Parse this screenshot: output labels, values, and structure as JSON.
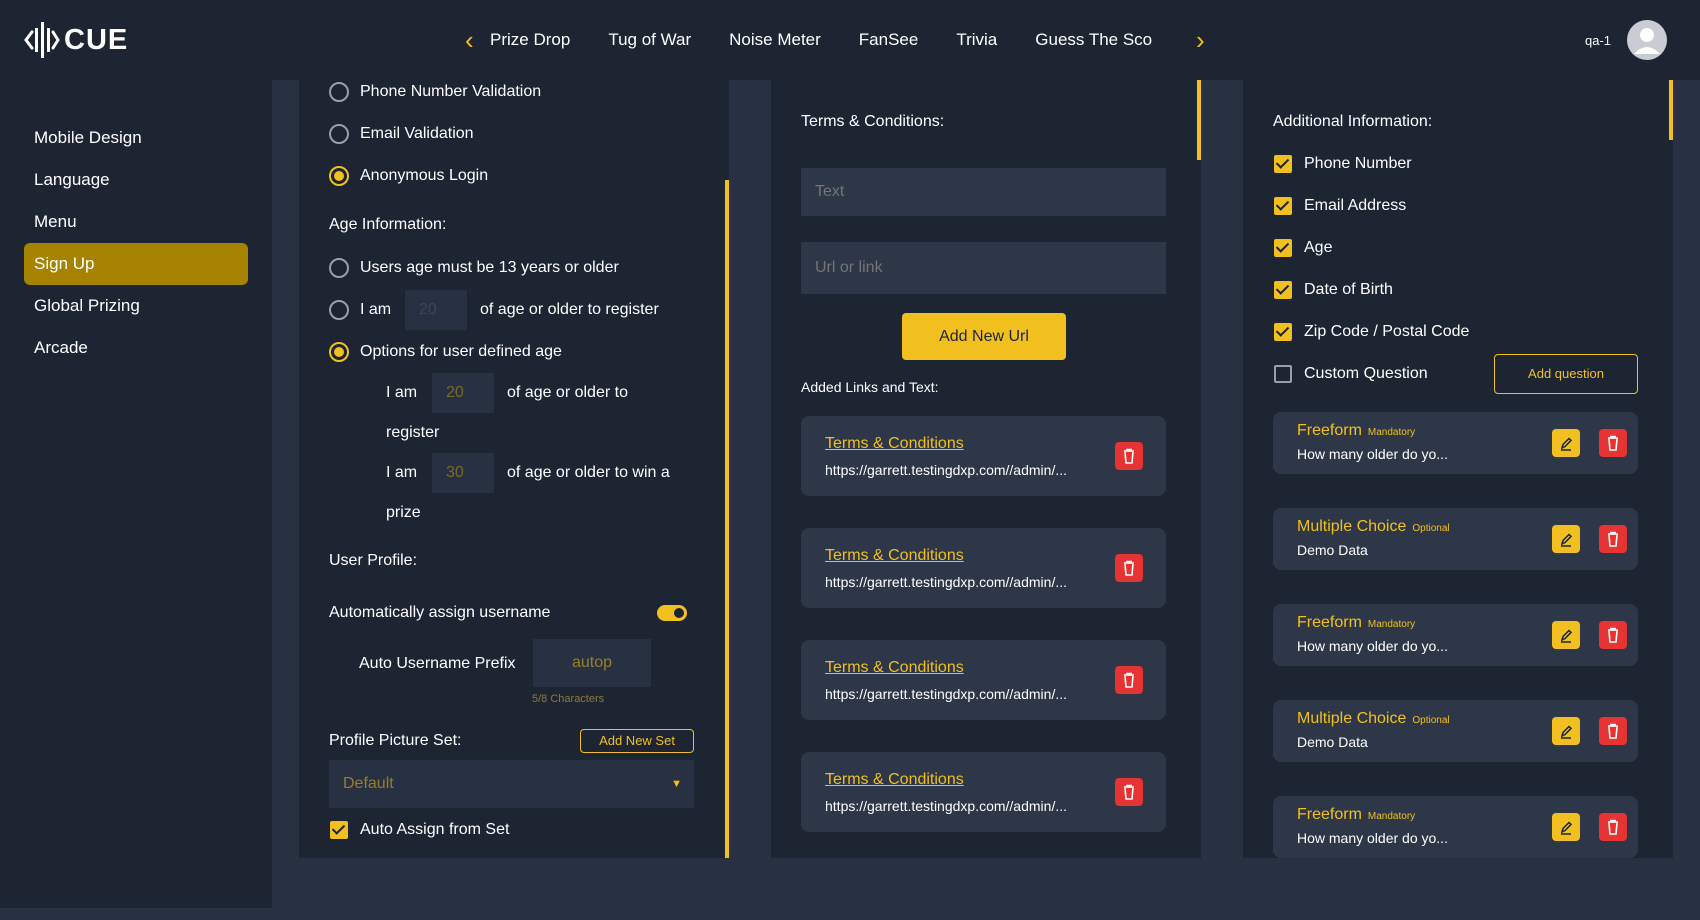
{
  "header": {
    "logo_text": "CUE",
    "tabs": [
      "Prize Drop",
      "Tug of War",
      "Noise Meter",
      "FanSee",
      "Trivia",
      "Guess The Sco"
    ],
    "user": "qa-1"
  },
  "sidebar": {
    "items": [
      "Mobile Design",
      "Language",
      "Menu",
      "Sign Up",
      "Global Prizing",
      "Arcade"
    ],
    "active": "Sign Up"
  },
  "left_panel": {
    "validation_options": [
      "Phone Number Validation",
      "Email Validation",
      "Anonymous Login"
    ],
    "age_heading": "Age Information:",
    "age_opt1": "Users age must be 13 years or older",
    "age_opt2_pre": "I am",
    "age_opt2_value": "20",
    "age_opt2_post": "of age or older to register",
    "age_opt3": "Options for user defined age",
    "sub1_pre": "I am",
    "sub1_value": "20",
    "sub1_post": "of age or older to",
    "sub1_post2": "register",
    "sub2_pre": "I am",
    "sub2_value": "30",
    "sub2_post": "of age or older to win a",
    "sub2_post2": "prize",
    "profile_heading": "User Profile:",
    "auto_username_label": "Automatically assign username",
    "prefix_label": "Auto Username Prefix",
    "prefix_value": "autop",
    "prefix_count": "5/8 Characters",
    "picture_set_label": "Profile Picture Set:",
    "add_set_button": "Add New Set",
    "picture_set_value": "Default",
    "auto_assign_label": "Auto Assign from Set"
  },
  "middle_panel": {
    "heading": "Terms & Conditions:",
    "text_placeholder": "Text",
    "url_placeholder": "Url or link",
    "add_url_button": "Add New Url",
    "added_heading": "Added Links and Text:",
    "links": [
      {
        "title": "Terms & Conditions",
        "url": "https://garrett.testingdxp.com//admin/..."
      },
      {
        "title": "Terms & Conditions",
        "url": "https://garrett.testingdxp.com//admin/..."
      },
      {
        "title": "Terms & Conditions",
        "url": "https://garrett.testingdxp.com//admin/..."
      },
      {
        "title": "Terms & Conditions",
        "url": "https://garrett.testingdxp.com//admin/..."
      }
    ]
  },
  "right_panel": {
    "heading": "Additional Information:",
    "checkboxes": [
      {
        "label": "Phone Number",
        "checked": true
      },
      {
        "label": "Email Address",
        "checked": true
      },
      {
        "label": "Age",
        "checked": true
      },
      {
        "label": "Date of Birth",
        "checked": true
      },
      {
        "label": "Zip Code / Postal Code",
        "checked": true
      },
      {
        "label": "Custom Question",
        "checked": false
      }
    ],
    "add_question_button": "Add question",
    "questions": [
      {
        "type": "Freeform",
        "badge": "Mandatory",
        "text": "How many older do yo..."
      },
      {
        "type": "Multiple Choice",
        "badge": "Optional",
        "text": "Demo Data"
      },
      {
        "type": "Freeform",
        "badge": "Mandatory",
        "text": "How many older do yo..."
      },
      {
        "type": "Multiple Choice",
        "badge": "Optional",
        "text": "Demo Data"
      },
      {
        "type": "Freeform",
        "badge": "Mandatory",
        "text": "How many older do yo..."
      }
    ]
  },
  "colors": {
    "accent": "#f2c01e",
    "active_nav": "#a68300",
    "panel_bg": "#1d2533",
    "page_bg": "#273142",
    "danger": "#e63333"
  }
}
